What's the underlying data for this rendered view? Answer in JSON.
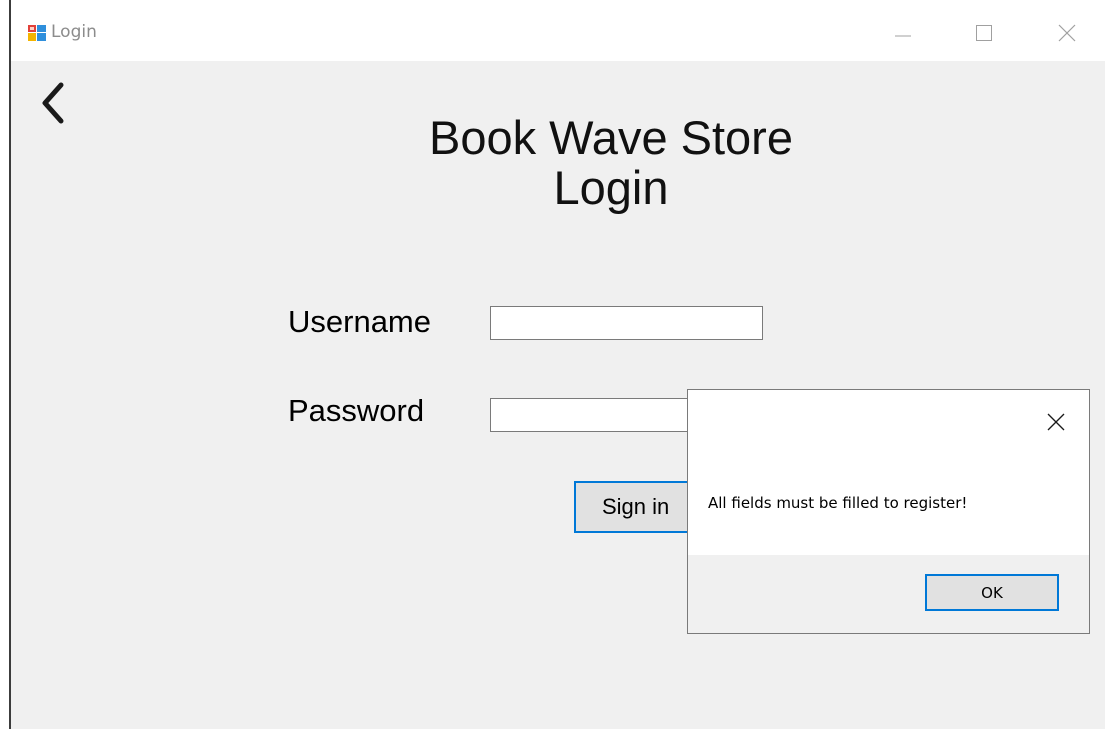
{
  "window": {
    "title": "Login"
  },
  "form": {
    "heading_line1": "Book Wave Store",
    "heading_line2": "Login",
    "username_label": "Username",
    "username_value": "",
    "password_label": "Password",
    "password_value": "",
    "signin_label": "Sign in"
  },
  "messagebox": {
    "message": "All fields must be filled to register!",
    "ok_label": "OK"
  },
  "colors": {
    "accent": "#0078d7",
    "client_bg": "#f0f0f0",
    "button_bg": "#e1e1e1"
  }
}
